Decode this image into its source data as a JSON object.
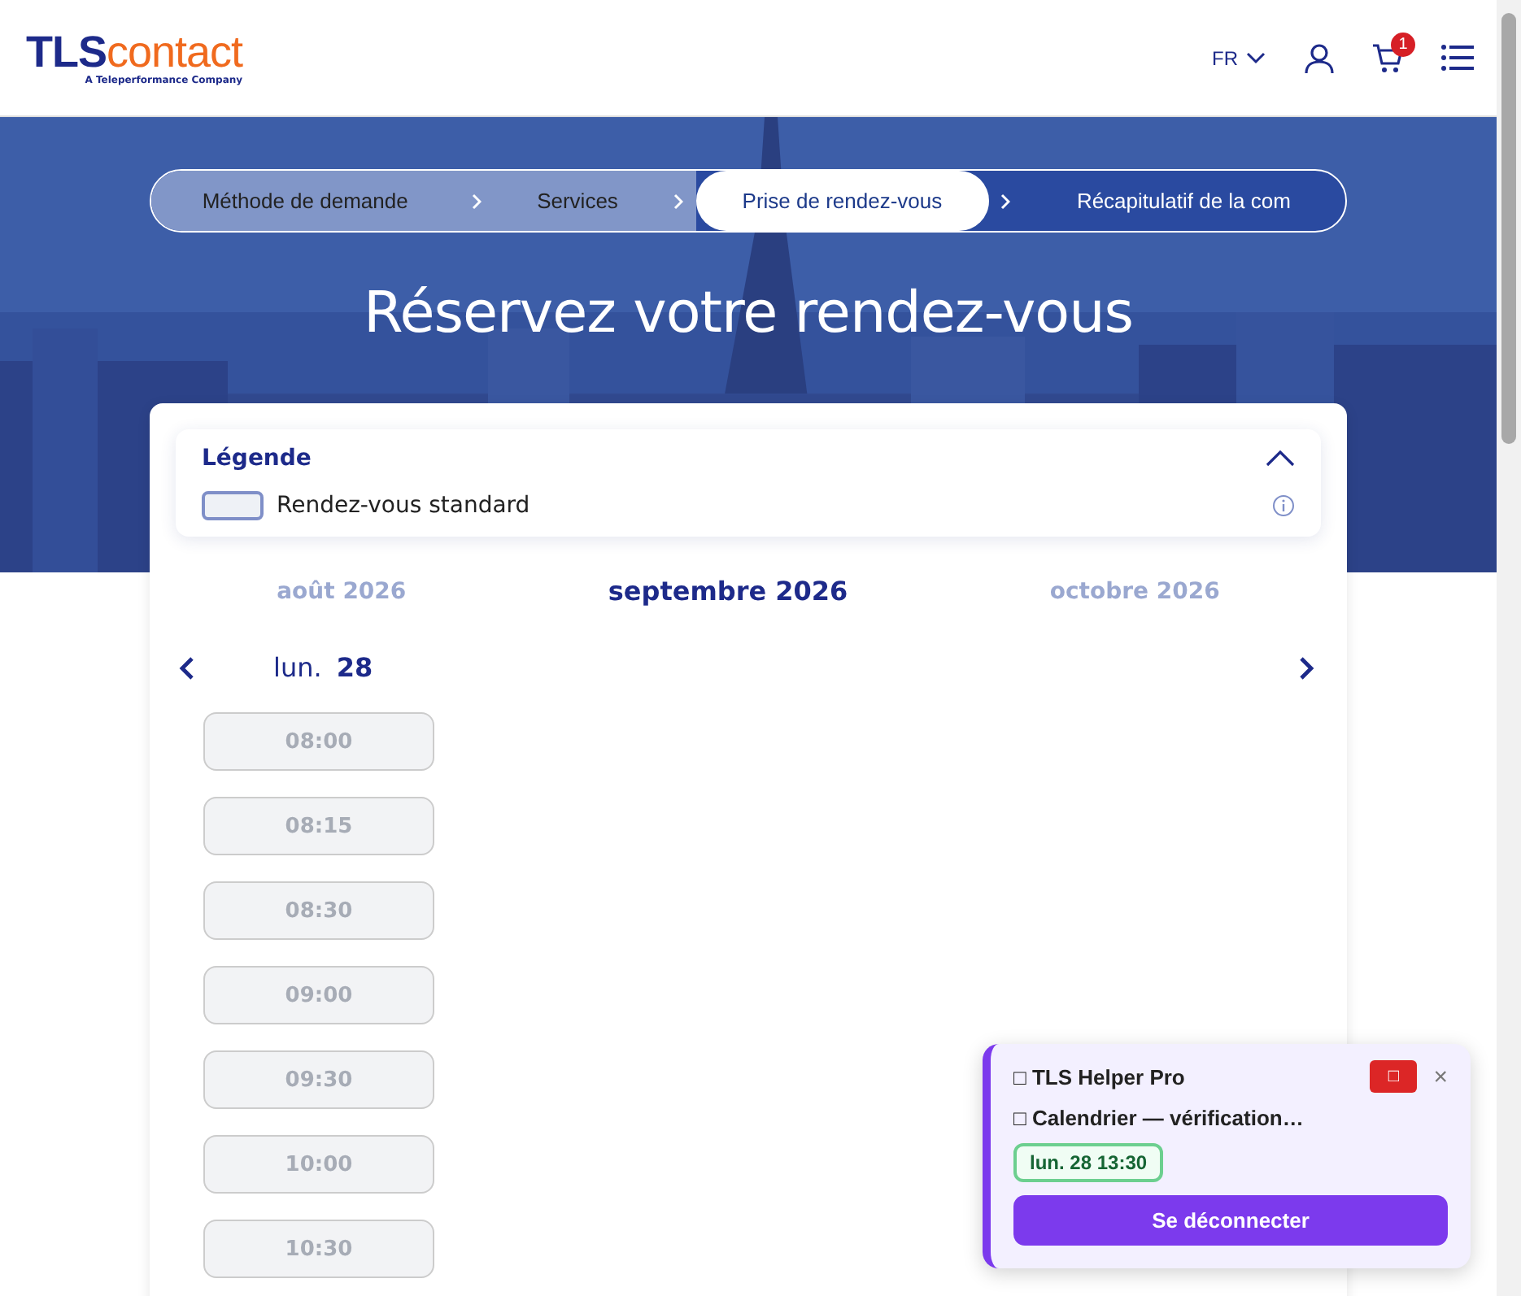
{
  "header": {
    "logo": {
      "brand_a": "TLS",
      "brand_b": "contact",
      "tagline": "A Teleperformance Company"
    },
    "language": "FR",
    "cart_count": "1"
  },
  "stepper": [
    {
      "label": "Méthode de demande",
      "completed": true,
      "selected": false
    },
    {
      "label": "Services",
      "completed": true,
      "selected": false
    },
    {
      "label": "Prise de rendez-vous",
      "completed": false,
      "selected": true
    },
    {
      "label": "Récapitulatif de la com",
      "completed": false,
      "selected": false
    }
  ],
  "title": "Réservez votre rendez-vous",
  "legend": {
    "title": "Légende",
    "expanded": true,
    "items": [
      {
        "label": "Rendez-vous standard"
      }
    ]
  },
  "months": [
    {
      "label": "août 2026",
      "selected": false
    },
    {
      "label": "septembre 2026",
      "selected": true
    },
    {
      "label": "octobre 2026",
      "selected": false
    }
  ],
  "day": {
    "weekday": "lun.",
    "date": "28"
  },
  "slots": [
    {
      "time": "08:00",
      "disabled": true
    },
    {
      "time": "08:15",
      "disabled": true
    },
    {
      "time": "08:30",
      "disabled": true
    },
    {
      "time": "09:00",
      "disabled": true
    },
    {
      "time": "09:30",
      "disabled": true
    },
    {
      "time": "10:00",
      "disabled": true
    },
    {
      "time": "10:30",
      "disabled": true
    }
  ],
  "helper": {
    "title": "□ TLS Helper Pro",
    "stop_button": "□",
    "close": "×",
    "status": "□ Calendrier — vérification…",
    "found": "lun. 28 13:30",
    "logout": "Se déconnecter"
  }
}
